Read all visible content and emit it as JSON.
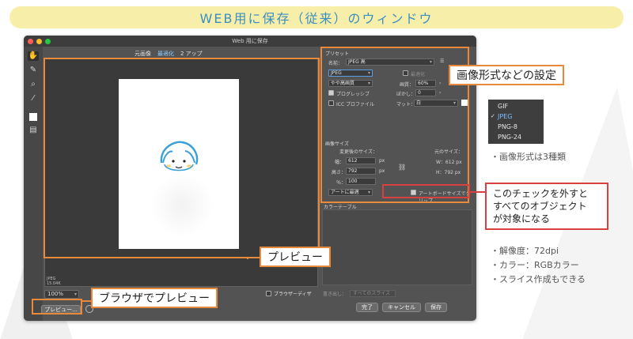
{
  "banner": {
    "title": "WEB用に保存（従来）のウィンドウ"
  },
  "window": {
    "title": "Web 用に保存",
    "dots": [
      "#ff5f57",
      "#febc2e",
      "#28c840"
    ],
    "view_tabs": [
      "元画像",
      "最適化",
      "2 アップ"
    ],
    "canvas_info": [
      "JPEG",
      "15.04K"
    ],
    "zoom": "100%",
    "preview_button": "プレビュー...",
    "browser_dither": "ブラウザーディザ",
    "export_label": "書き出し：",
    "export_value": "すべてのスライス",
    "buttons": {
      "done": "完了",
      "cancel": "キャンセル",
      "save": "保存"
    }
  },
  "panel": {
    "preset_section": "プリセット",
    "name_label": "名前：",
    "name_value": "JPEG 高",
    "format_value": "JPEG",
    "optimize_label": "最適化",
    "compression_value": "やや高画質",
    "quality_label": "画質：",
    "quality_value": "60%",
    "progressive_label": "プログレッシブ",
    "blur_label": "ぼかし：",
    "blur_value": "0",
    "icc_label": "ICC プロファイル",
    "matte_label": "マット：",
    "matte_value": "白",
    "size_section": "画像サイズ",
    "new_size_label": "変更後のサイズ：",
    "orig_size_label": "元のサイズ：",
    "width_label": "幅：",
    "width_value": "612",
    "height_label": "高さ：",
    "height_value": "792",
    "unit": "px",
    "percent_label": "％：",
    "percent_value": "100",
    "orig_w": "W：612 px",
    "orig_h": "H：792 px",
    "resample_value": "アートに最適",
    "clip_label": "アートボードサイズでクリップ",
    "color_table_section": "カラーテーブル"
  },
  "callouts": {
    "format_settings": "画像形式などの設定",
    "preview": "プレビュー",
    "browser_preview": "ブラウザでプレビュー",
    "clip_note": [
      "このチェックを外すと",
      "すべてのオブジェクト",
      "が対象になる"
    ]
  },
  "format_menu": {
    "items": [
      "GIF",
      "JPEG",
      "PNG-8",
      "PNG-24"
    ],
    "selected": "JPEG"
  },
  "notes": {
    "formats": "・画像形式は3種類",
    "details": [
      "・解像度：72dpi",
      "・カラー：RGBカラー",
      "・スライス作成もできる"
    ]
  }
}
